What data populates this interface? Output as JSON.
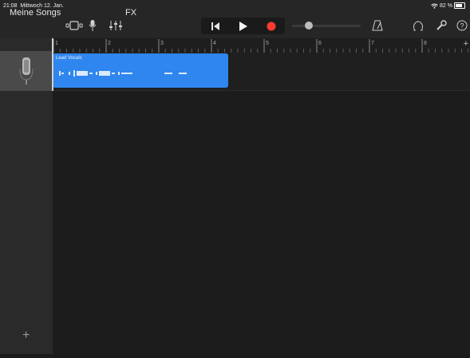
{
  "status_bar": {
    "time": "21:08",
    "date": "Mittwoch 12. Jan.",
    "battery": "82 %"
  },
  "toolbar": {
    "my_songs": "Meine Songs",
    "fx": "FX",
    "icons": [
      "browser-view-icon",
      "microphone-icon",
      "mixer-icon",
      "go-to-start-icon",
      "play-icon",
      "record-icon",
      "metronome-icon",
      "loop-icon",
      "settings-wrench-icon",
      "help-icon"
    ]
  },
  "transport": {
    "record_color": "#ff3b30",
    "volume_level": 0.2
  },
  "ruler": {
    "bars": [
      "1",
      "2",
      "3",
      "4",
      "5",
      "6",
      "7",
      "8"
    ],
    "add": "+"
  },
  "track": {
    "instrument_icon": "microphone-icon",
    "region_name": "Lead Vocals",
    "region_color": "#2f86ee"
  },
  "sidebar": {
    "add_track": "+"
  }
}
